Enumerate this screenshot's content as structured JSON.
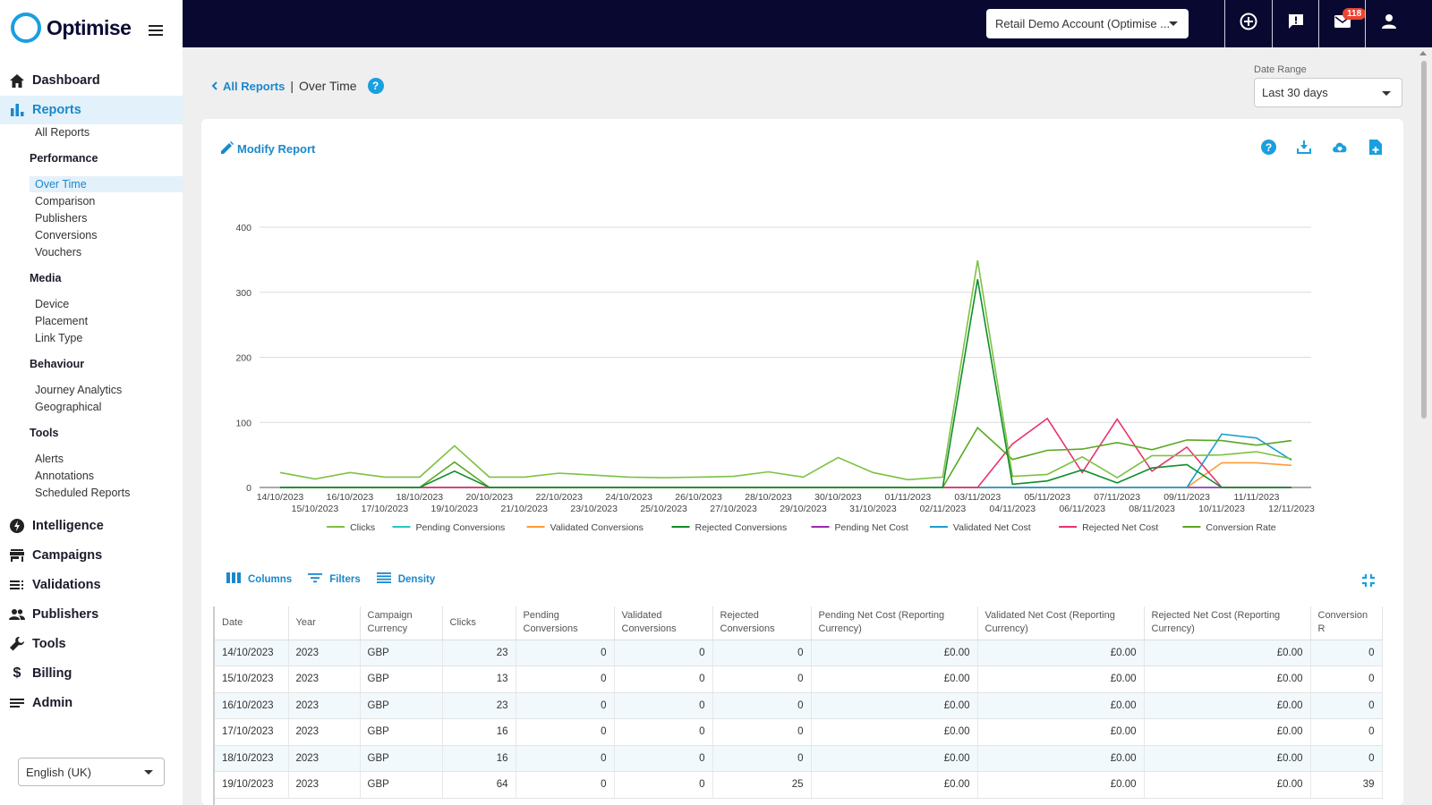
{
  "app": {
    "logo_text": "Optimise"
  },
  "sidebar": {
    "main": [
      {
        "label": "Dashboard",
        "icon": "home-icon"
      },
      {
        "label": "Reports",
        "icon": "bar-chart-icon",
        "active": true
      },
      {
        "label": "Intelligence",
        "icon": "bolt-icon"
      },
      {
        "label": "Campaigns",
        "icon": "store-icon"
      },
      {
        "label": "Validations",
        "icon": "checklist-icon"
      },
      {
        "label": "Publishers",
        "icon": "people-icon"
      },
      {
        "label": "Tools",
        "icon": "wrench-icon"
      },
      {
        "label": "Billing",
        "icon": "dollar-icon"
      },
      {
        "label": "Admin",
        "icon": "lines-icon"
      }
    ],
    "reports_sub": {
      "all_reports": "All Reports",
      "groups": [
        {
          "title": "Performance",
          "items": [
            "Over Time",
            "Comparison",
            "Publishers",
            "Conversions",
            "Vouchers"
          ]
        },
        {
          "title": "Media",
          "items": [
            "Device",
            "Placement",
            "Link Type"
          ]
        },
        {
          "title": "Behaviour",
          "items": [
            "Journey Analytics",
            "Geographical"
          ]
        },
        {
          "title": "Tools",
          "items": [
            "Alerts",
            "Annotations",
            "Scheduled Reports"
          ]
        }
      ],
      "active_item": "Over Time"
    },
    "language": "English (UK)"
  },
  "topbar": {
    "account": "Retail Demo Account (Optimise ...",
    "icons": [
      "add-circle-icon",
      "feedback-icon",
      "mail-icon",
      "user-icon"
    ],
    "mail_badge": "118"
  },
  "breadcrumb": {
    "back_label": "All Reports",
    "separator": "|",
    "current": "Over Time",
    "help": "?"
  },
  "date_range": {
    "label": "Date Range",
    "value": "Last 30 days"
  },
  "card": {
    "modify_label": "Modify Report",
    "icons": [
      "help-icon",
      "download-icon",
      "cloud-download-icon",
      "add-document-icon"
    ]
  },
  "grid_toolbar": {
    "columns": "Columns",
    "filters": "Filters",
    "density": "Density"
  },
  "colors": {
    "accent": "#1a88cc",
    "topbar": "#080830"
  },
  "chart_data": {
    "type": "line",
    "title": "",
    "xlabel": "",
    "ylabel": "",
    "ylim": [
      0,
      400
    ],
    "yticks": [
      0,
      100,
      200,
      300,
      400
    ],
    "grid": true,
    "legend_position": "bottom",
    "x": [
      "14/10/2023",
      "15/10/2023",
      "16/10/2023",
      "17/10/2023",
      "18/10/2023",
      "19/10/2023",
      "20/10/2023",
      "21/10/2023",
      "22/10/2023",
      "23/10/2023",
      "24/10/2023",
      "25/10/2023",
      "26/10/2023",
      "27/10/2023",
      "28/10/2023",
      "29/10/2023",
      "30/10/2023",
      "31/10/2023",
      "01/11/2023",
      "02/11/2023",
      "03/11/2023",
      "04/11/2023",
      "05/11/2023",
      "06/11/2023",
      "07/11/2023",
      "08/11/2023",
      "09/11/2023",
      "10/11/2023",
      "11/11/2023",
      "12/11/2023"
    ],
    "series": [
      {
        "name": "Clicks",
        "color": "#7dc142",
        "values": [
          23,
          13,
          23,
          16,
          16,
          64,
          16,
          16,
          22,
          19,
          16,
          15,
          16,
          17,
          24,
          16,
          46,
          23,
          12,
          16,
          349,
          17,
          20,
          47,
          15,
          49,
          49,
          50,
          55,
          44
        ]
      },
      {
        "name": "Pending Conversions",
        "color": "#26c6c6",
        "values": [
          0,
          0,
          0,
          0,
          0,
          0,
          0,
          0,
          0,
          0,
          0,
          0,
          0,
          0,
          0,
          0,
          0,
          0,
          0,
          0,
          0,
          0,
          0,
          0,
          0,
          0,
          0,
          0,
          0,
          0
        ]
      },
      {
        "name": "Validated Conversions",
        "color": "#ff9933",
        "values": [
          0,
          0,
          0,
          0,
          0,
          0,
          0,
          0,
          0,
          0,
          0,
          0,
          0,
          0,
          0,
          0,
          0,
          0,
          0,
          0,
          0,
          0,
          0,
          0,
          0,
          0,
          0,
          38,
          38,
          34
        ]
      },
      {
        "name": "Rejected Conversions",
        "color": "#0e8e2a",
        "values": [
          0,
          0,
          0,
          0,
          0,
          25,
          0,
          0,
          0,
          0,
          0,
          0,
          0,
          0,
          0,
          0,
          0,
          0,
          0,
          0,
          320,
          5,
          10,
          27,
          7,
          30,
          35,
          0,
          0,
          0
        ]
      },
      {
        "name": "Pending Net Cost",
        "color": "#9c27b0",
        "values": [
          0,
          0,
          0,
          0,
          0,
          0,
          0,
          0,
          0,
          0,
          0,
          0,
          0,
          0,
          0,
          0,
          0,
          0,
          0,
          0,
          0,
          0,
          0,
          0,
          0,
          0,
          0,
          0,
          0,
          0
        ]
      },
      {
        "name": "Validated Net Cost",
        "color": "#1a9fd0",
        "values": [
          0,
          0,
          0,
          0,
          0,
          0,
          0,
          0,
          0,
          0,
          0,
          0,
          0,
          0,
          0,
          0,
          0,
          0,
          0,
          0,
          0,
          0,
          0,
          0,
          0,
          0,
          0,
          82,
          76,
          42
        ]
      },
      {
        "name": "Rejected Net Cost",
        "color": "#e8336d",
        "values": [
          0,
          0,
          0,
          0,
          0,
          0,
          0,
          0,
          0,
          0,
          0,
          0,
          0,
          0,
          0,
          0,
          0,
          0,
          0,
          0,
          0,
          67,
          106,
          23,
          105,
          25,
          62,
          0,
          0,
          0
        ]
      },
      {
        "name": "Conversion Rate",
        "color": "#5aa820",
        "values": [
          0,
          0,
          0,
          0,
          0,
          39,
          0,
          0,
          0,
          0,
          0,
          0,
          0,
          0,
          0,
          0,
          0,
          0,
          0,
          0,
          92,
          43,
          57,
          59,
          69,
          58,
          73,
          72,
          65,
          72
        ]
      }
    ]
  },
  "table": {
    "columns": [
      "Date",
      "Year",
      "Campaign Currency",
      "Clicks",
      "Pending Conversions",
      "Validated Conversions",
      "Rejected Conversions",
      "Pending Net Cost (Reporting Currency)",
      "Validated Net Cost (Reporting Currency)",
      "Rejected Net Cost (Reporting Currency)",
      "Conversion R"
    ],
    "rows": [
      [
        "14/10/2023",
        "2023",
        "GBP",
        "23",
        "0",
        "0",
        "0",
        "£0.00",
        "£0.00",
        "£0.00",
        "0"
      ],
      [
        "15/10/2023",
        "2023",
        "GBP",
        "13",
        "0",
        "0",
        "0",
        "£0.00",
        "£0.00",
        "£0.00",
        "0"
      ],
      [
        "16/10/2023",
        "2023",
        "GBP",
        "23",
        "0",
        "0",
        "0",
        "£0.00",
        "£0.00",
        "£0.00",
        "0"
      ],
      [
        "17/10/2023",
        "2023",
        "GBP",
        "16",
        "0",
        "0",
        "0",
        "£0.00",
        "£0.00",
        "£0.00",
        "0"
      ],
      [
        "18/10/2023",
        "2023",
        "GBP",
        "16",
        "0",
        "0",
        "0",
        "£0.00",
        "£0.00",
        "£0.00",
        "0"
      ],
      [
        "19/10/2023",
        "2023",
        "GBP",
        "64",
        "0",
        "0",
        "25",
        "£0.00",
        "£0.00",
        "£0.00",
        "39"
      ]
    ]
  }
}
